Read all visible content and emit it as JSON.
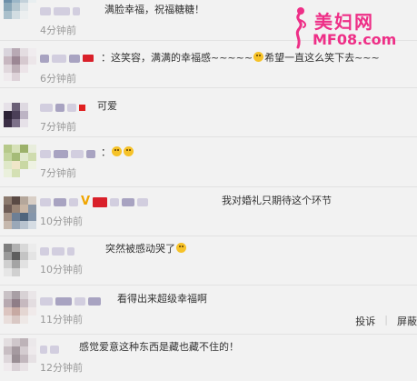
{
  "comments": [
    {
      "text": "满脸幸福，祝福糖糖！",
      "time": "4分钟前"
    },
    {
      "text": "：这笑容，满满的幸福感~~~~~",
      "text_after": "希望一直这么笑下去~~~",
      "time": "6分钟前"
    },
    {
      "text": "可爱",
      "time": "7分钟前"
    },
    {
      "text": "：",
      "time": "7分钟前"
    },
    {
      "text": "我对婚礼只期待这个环节",
      "time": "10分钟前"
    },
    {
      "text": "突然被感动哭了",
      "time": "10分钟前"
    },
    {
      "text": "看得出来超级幸福啊",
      "time": "11分钟前",
      "actions": {
        "report": "投诉",
        "block": "屏蔽"
      }
    },
    {
      "text": "感觉爱意这种东西是藏也藏不住的！",
      "time": "12分钟前"
    }
  ],
  "watermark": {
    "logo_text": "美妇网",
    "url": "MF08.com"
  },
  "colors": {
    "background": "#f2f2f2",
    "time": "#999999",
    "watermark": "#ee2f87",
    "badge": "#d9202a"
  }
}
